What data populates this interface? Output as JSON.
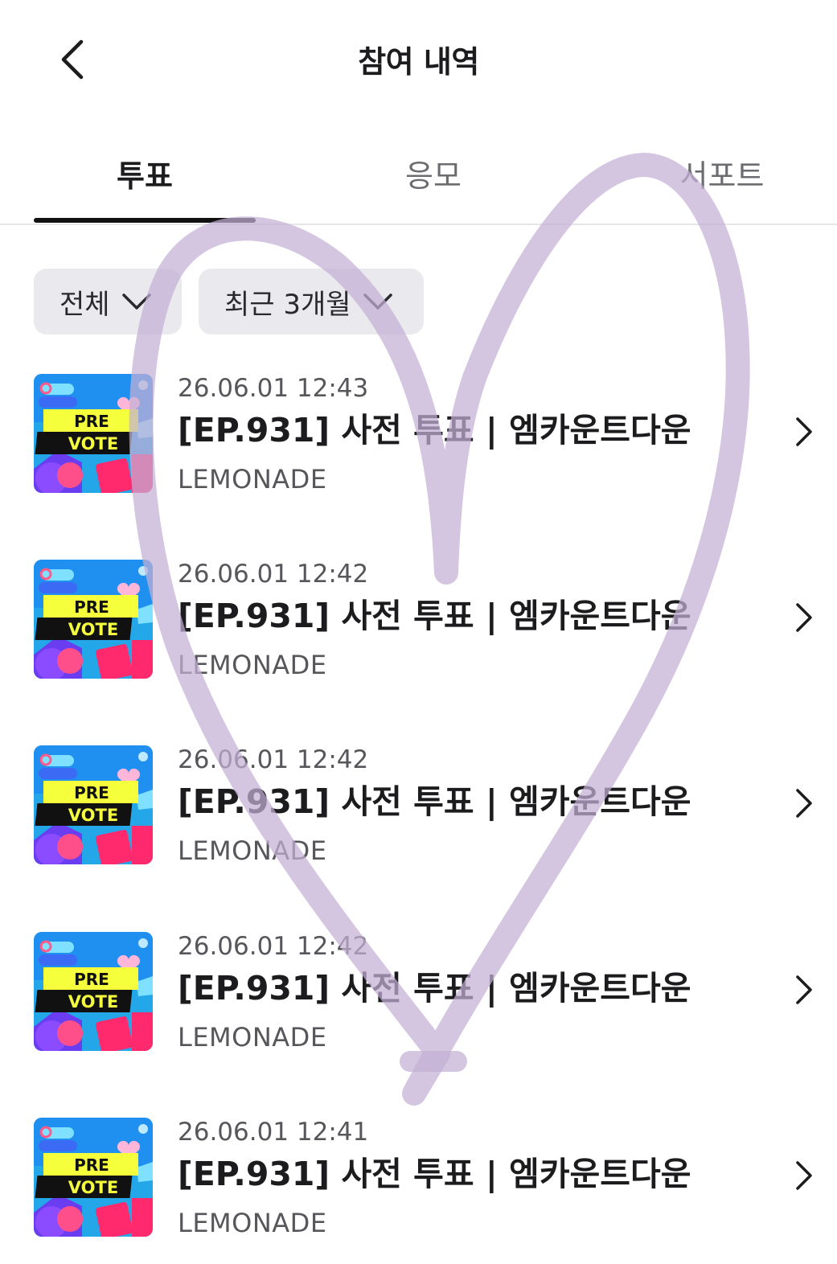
{
  "header": {
    "title": "참여 내역",
    "back_icon": "chevron-left-icon"
  },
  "tabs": [
    {
      "label": "투표",
      "active": true
    },
    {
      "label": "응모",
      "active": false
    },
    {
      "label": "서포트",
      "active": false
    }
  ],
  "filters": [
    {
      "label": "전체",
      "icon": "chevron-down-icon"
    },
    {
      "label": "최근 3개월",
      "icon": "chevron-down-icon"
    }
  ],
  "items": [
    {
      "date": "26.06.01 12:43",
      "title": "[EP.931] 사전 투표 | 엠카운트다운",
      "subtitle": "LEMONADE",
      "thumb_text_1": "PRE",
      "thumb_text_2": "VOTE"
    },
    {
      "date": "26.06.01 12:42",
      "title": "[EP.931] 사전 투표 | 엠카운트다운",
      "subtitle": "LEMONADE",
      "thumb_text_1": "PRE",
      "thumb_text_2": "VOTE"
    },
    {
      "date": "26.06.01 12:42",
      "title": "[EP.931] 사전 투표 | 엠카운트다운",
      "subtitle": "LEMONADE",
      "thumb_text_1": "PRE",
      "thumb_text_2": "VOTE"
    },
    {
      "date": "26.06.01 12:42",
      "title": "[EP.931] 사전 투표 | 엠카운트다운",
      "subtitle": "LEMONADE",
      "thumb_text_1": "PRE",
      "thumb_text_2": "VOTE"
    },
    {
      "date": "26.06.01 12:41",
      "title": "[EP.931] 사전 투표 | 엠카운트다운",
      "subtitle": "LEMONADE",
      "thumb_text_1": "PRE",
      "thumb_text_2": "VOTE"
    }
  ],
  "colors": {
    "active_tab_underline": "#111111",
    "filter_bg": "#eaeaee",
    "heart_overlay": "#c3b0d6"
  }
}
